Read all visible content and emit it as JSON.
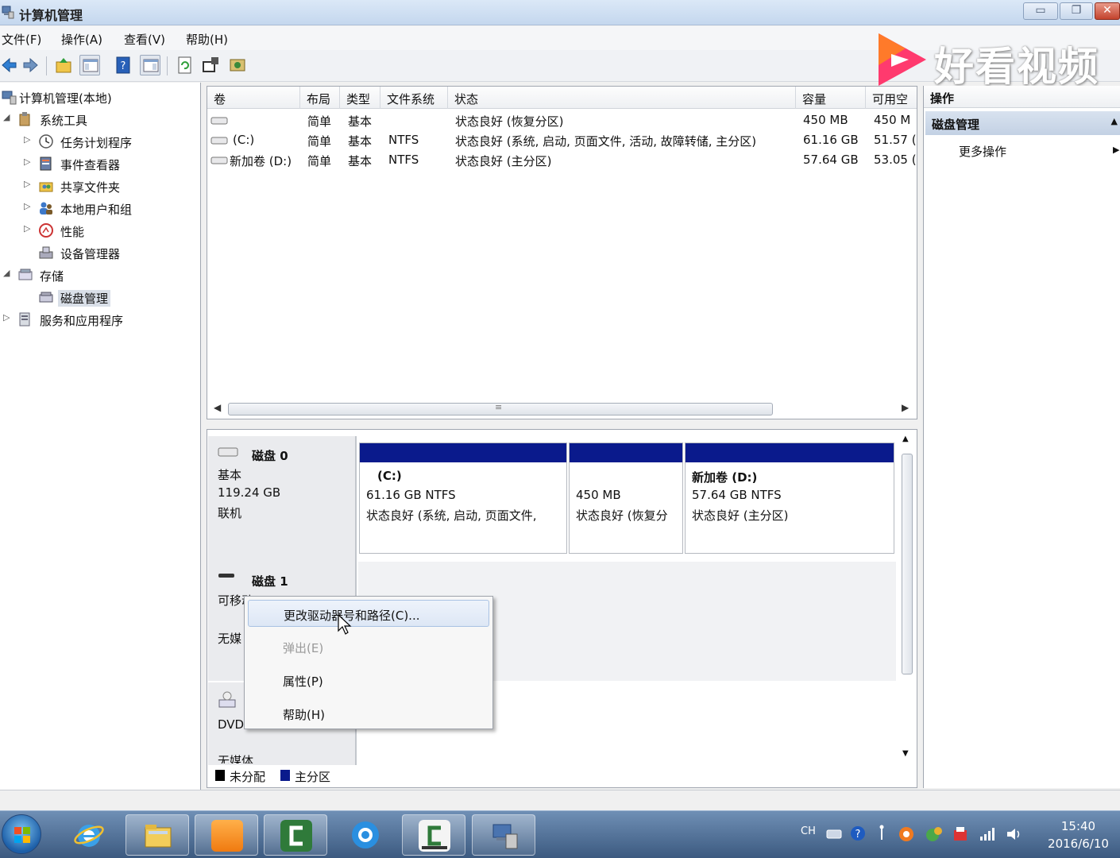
{
  "window": {
    "title": "计算机管理",
    "min_glyph": "▭",
    "max_glyph": "❐",
    "close_glyph": "✕"
  },
  "menu": [
    "文件(F)",
    "操作(A)",
    "查看(V)",
    "帮助(H)"
  ],
  "watermark": {
    "text": "好看视频"
  },
  "tree": {
    "root": "计算机管理(本地)",
    "system_tools": "系统工具",
    "task_scheduler": "任务计划程序",
    "event_viewer": "事件查看器",
    "shared_folders": "共享文件夹",
    "local_users": "本地用户和组",
    "performance": "性能",
    "device_manager": "设备管理器",
    "storage": "存储",
    "disk_management": "磁盘管理",
    "services_apps": "服务和应用程序"
  },
  "volume_list": {
    "columns": [
      "卷",
      "布局",
      "类型",
      "文件系统",
      "状态",
      "容量",
      "可用空"
    ],
    "rows": [
      {
        "volume": "",
        "layout": "简单",
        "type": "基本",
        "fs": "",
        "status": "状态良好 (恢复分区)",
        "capacity": "450 MB",
        "free": "450 M"
      },
      {
        "volume": "(C:)",
        "layout": "简单",
        "type": "基本",
        "fs": "NTFS",
        "status": "状态良好 (系统, 启动, 页面文件, 活动, 故障转储, 主分区)",
        "capacity": "61.16 GB",
        "free": "51.57 ("
      },
      {
        "volume": "新加卷 (D:)",
        "layout": "简单",
        "type": "基本",
        "fs": "NTFS",
        "status": "状态良好 (主分区)",
        "capacity": "57.64 GB",
        "free": "53.05 ("
      }
    ],
    "scroll_grip": "≡"
  },
  "disks": {
    "disk0": {
      "name": "磁盘 0",
      "type": "基本",
      "size": "119.24 GB",
      "state": "联机",
      "partitions": [
        {
          "title": "(C:)",
          "size": "61.16 GB NTFS",
          "status": "状态良好 (系统, 启动, 页面文件,"
        },
        {
          "title": "",
          "size": "450 MB",
          "status": "状态良好 (恢复分"
        },
        {
          "title": "新加卷  (D:)",
          "size": "57.64 GB NTFS",
          "status": "状态良好 (主分区)"
        }
      ]
    },
    "disk1": {
      "name": "磁盘 1",
      "type": "可移动",
      "media": "无媒"
    },
    "dvd": {
      "label": "DVD",
      "media": "无媒体"
    }
  },
  "legend": {
    "unallocated": "未分配",
    "primary": "主分区"
  },
  "actions": {
    "header": "操作",
    "section": "磁盘管理",
    "more": "更多操作"
  },
  "context_menu": {
    "items": [
      "更改驱动器号和路径(C)...",
      "弹出(E)",
      "属性(P)",
      "帮助(H)"
    ]
  },
  "tray": {
    "ime": "CH"
  },
  "clock": {
    "time": "15:40",
    "date": "2016/6/10"
  },
  "colors": {
    "partition_bar": "#0a1a8c",
    "unallocated": "#000000",
    "primary": "#0a1a8c"
  }
}
